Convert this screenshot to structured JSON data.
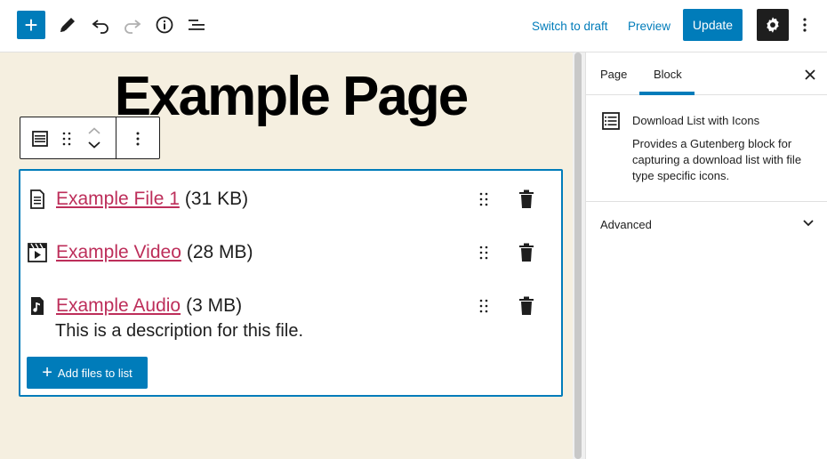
{
  "toolbar": {
    "inserter_label": "+",
    "switch_to_draft": "Switch to draft",
    "preview": "Preview",
    "update": "Update"
  },
  "editor": {
    "page_title": "Example Page",
    "files": [
      {
        "name": "Example File 1",
        "size": "(31 KB)",
        "icon": "document-icon"
      },
      {
        "name": "Example Video",
        "size": "(28 MB)",
        "icon": "video-icon"
      },
      {
        "name": "Example Audio",
        "size": "(3 MB)",
        "icon": "audio-icon",
        "description": "This is a description for this file."
      }
    ],
    "add_files_label": "Add files to list"
  },
  "sidebar": {
    "tabs": [
      {
        "label": "Page",
        "active": false
      },
      {
        "label": "Block",
        "active": true
      }
    ],
    "block": {
      "title": "Download List with Icons",
      "description": "Provides a Gutenberg block for capturing a download list with file type specific icons."
    },
    "advanced_label": "Advanced"
  },
  "colors": {
    "accent": "#007cba",
    "link": "#bd2e5a",
    "canvas_bg": "#f5efe0",
    "dark": "#1e1e1e"
  }
}
